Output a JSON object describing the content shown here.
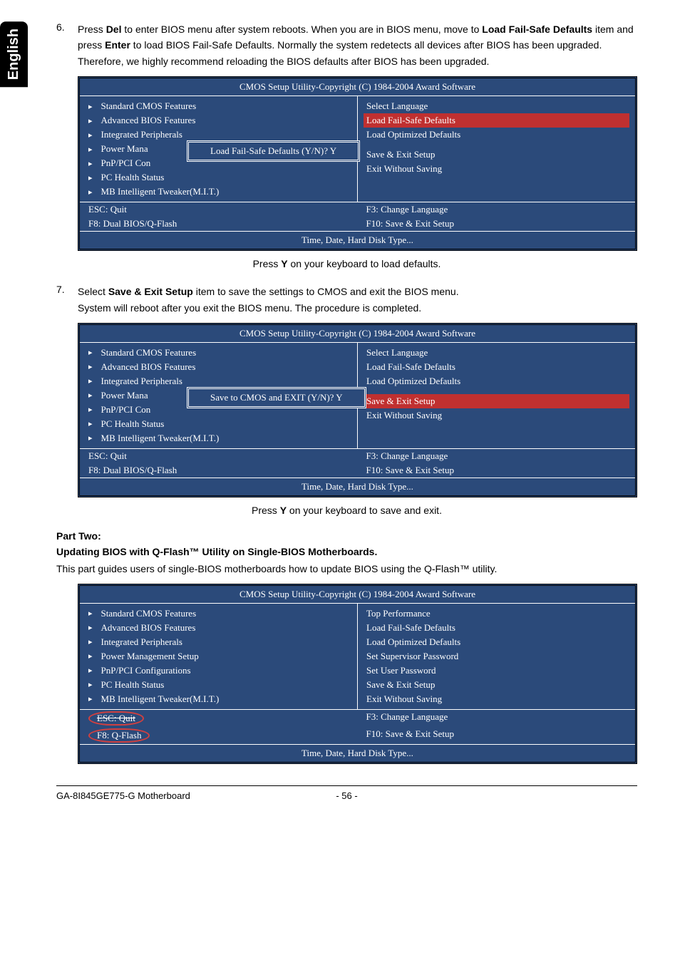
{
  "sidebar": {
    "label": "English"
  },
  "step6": {
    "num": "6.",
    "pre": "Press ",
    "del": "Del",
    "mid1": " to enter BIOS menu after system reboots. When you are in BIOS menu, move to ",
    "lfsd": "Load Fail-Safe Defaults",
    "mid2": " item and press ",
    "enter": "Enter",
    "end": " to load BIOS Fail-Safe Defaults. Normally the system redetects all devices after BIOS has been upgraded. Therefore, we highly recommend reloading the BIOS defaults after BIOS has been upgraded."
  },
  "bios1": {
    "title": "CMOS Setup Utility-Copyright (C) 1984-2004 Award Software",
    "left": [
      "Standard CMOS Features",
      "Advanced BIOS Features",
      "Integrated Peripherals",
      "Power Mana",
      "PnP/PCI Con",
      "PC Health Status",
      "MB Intelligent Tweaker(M.I.T.)"
    ],
    "right": [
      "Select Language",
      "Load Fail-Safe Defaults",
      "Load Optimized Defaults",
      "",
      "",
      "Save & Exit Setup",
      "Exit Without Saving"
    ],
    "dialog": "Load Fail-Safe Defaults (Y/N)? Y",
    "footer_l1": "ESC: Quit",
    "footer_r1": "F3: Change Language",
    "footer_l2": "F8: Dual BIOS/Q-Flash",
    "footer_r2": "F10: Save & Exit Setup",
    "status": "Time, Date, Hard Disk Type..."
  },
  "caption1": {
    "pre": "Press ",
    "key": "Y",
    "post": " on your keyboard to load defaults."
  },
  "step7": {
    "num": "7.",
    "pre": "Select ",
    "item": "Save & Exit Setup",
    "mid": " item to save the settings to CMOS and exit the BIOS menu.",
    "line2": "System will reboot after you exit the BIOS menu. The procedure is completed."
  },
  "bios2": {
    "title": "CMOS Setup Utility-Copyright (C) 1984-2004 Award Software",
    "left": [
      "Standard CMOS Features",
      "Advanced BIOS Features",
      "Integrated Peripherals",
      "Power Mana",
      "PnP/PCI Con",
      "PC Health Status",
      "MB Intelligent Tweaker(M.I.T.)"
    ],
    "right": [
      "Select Language",
      "Load Fail-Safe Defaults",
      "Load Optimized Defaults",
      "",
      "",
      "Save & Exit Setup",
      "Exit Without Saving"
    ],
    "dialog": "Save to CMOS and EXIT (Y/N)? Y",
    "footer_l1": "ESC: Quit",
    "footer_r1": "F3: Change Language",
    "footer_l2": "F8: Dual BIOS/Q-Flash",
    "footer_r2": "F10: Save & Exit Setup",
    "status": "Time, Date, Hard Disk Type..."
  },
  "caption2": {
    "pre": "Press ",
    "key": "Y",
    "post": " on your keyboard to save and exit."
  },
  "part2": {
    "heading": "Part Two:",
    "subheading": "Updating BIOS with Q-Flash™ Utility on Single-BIOS Motherboards.",
    "body": "This part guides users of single-BIOS motherboards how to update BIOS using the Q-Flash™ utility."
  },
  "bios3": {
    "title": "CMOS Setup Utility-Copyright (C) 1984-2004 Award Software",
    "left": [
      "Standard CMOS Features",
      "Advanced BIOS Features",
      "Integrated Peripherals",
      "Power Management Setup",
      "PnP/PCI Configurations",
      "PC Health Status",
      "MB Intelligent Tweaker(M.I.T.)"
    ],
    "right": [
      "Top Performance",
      "Load Fail-Safe Defaults",
      "Load Optimized Defaults",
      "Set Supervisor Password",
      "Set User Password",
      "Save & Exit Setup",
      "Exit Without Saving"
    ],
    "footer_l1": "ESC: Quit",
    "footer_r1": "F3: Change Language",
    "footer_l2": "F8: Q-Flash",
    "footer_r2": "F10: Save & Exit Setup",
    "status": "Time, Date, Hard Disk Type..."
  },
  "footer": {
    "left": "GA-8I845GE775-G Motherboard",
    "mid": "- 56 -"
  }
}
